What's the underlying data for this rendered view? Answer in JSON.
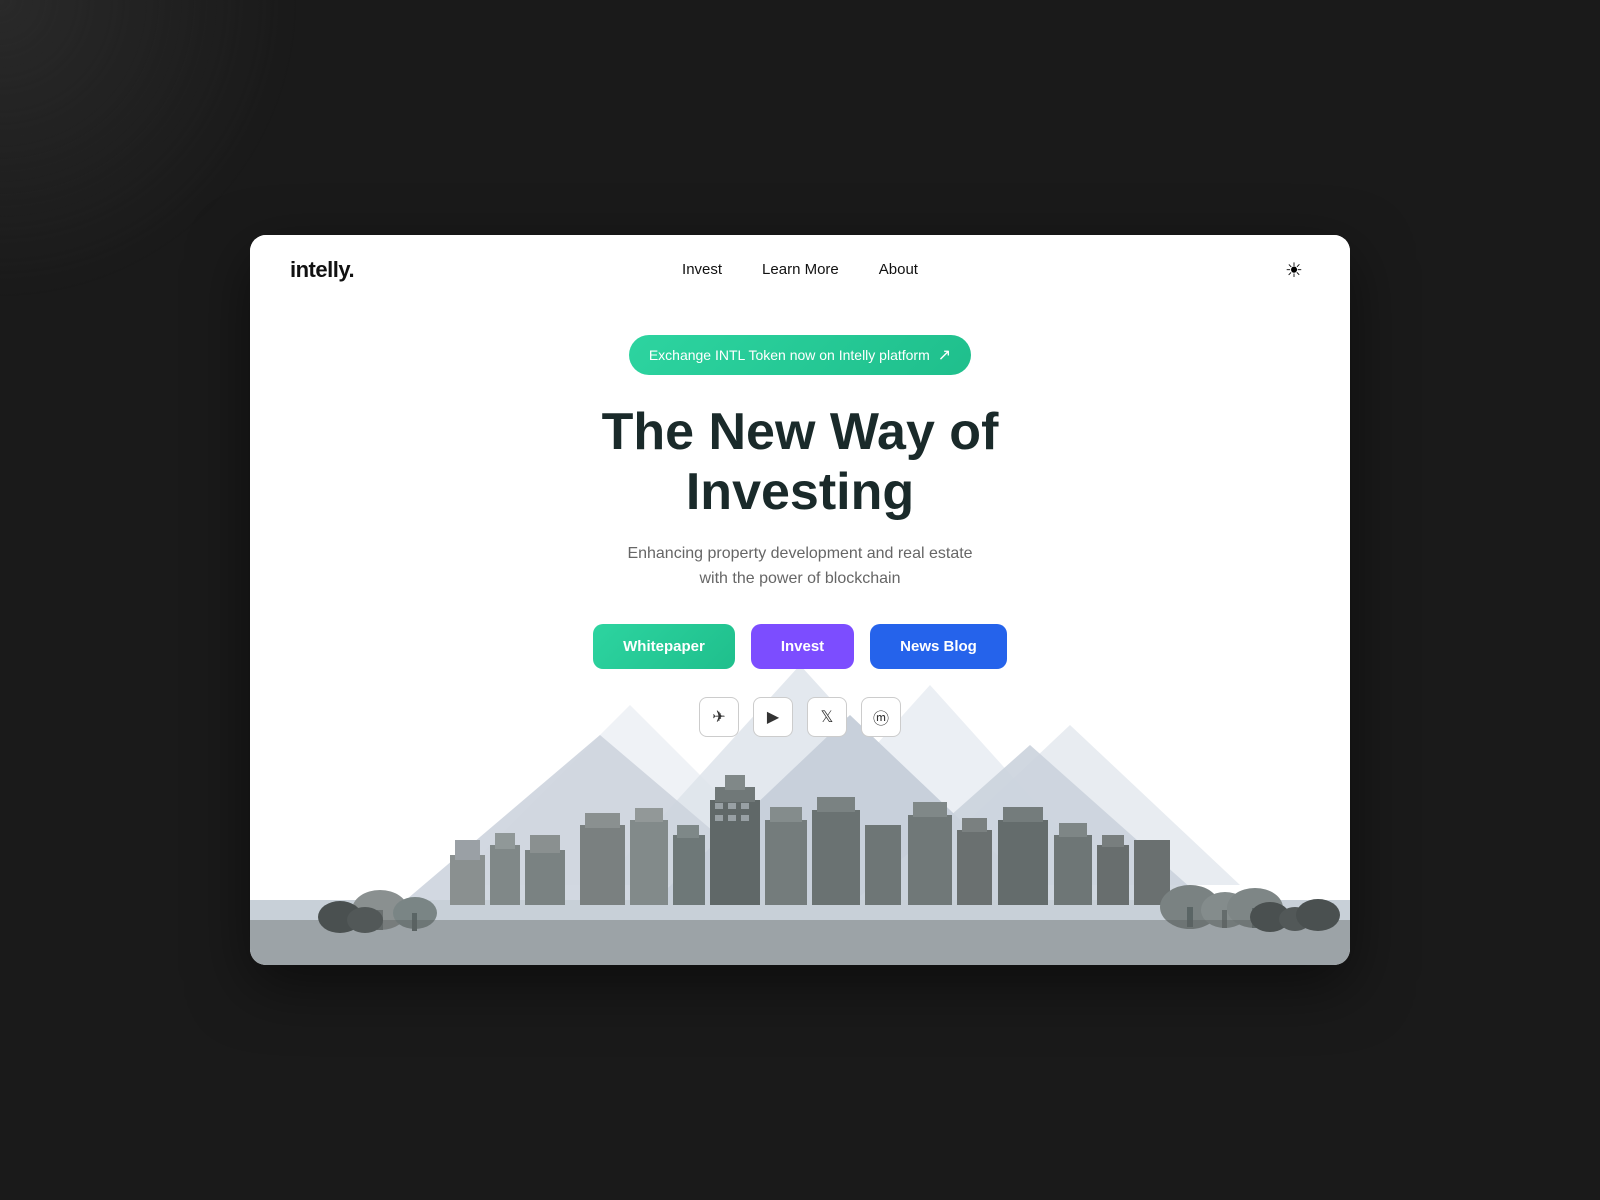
{
  "logo": {
    "text": "intelly."
  },
  "navbar": {
    "links": [
      {
        "label": "Invest",
        "id": "nav-invest"
      },
      {
        "label": "Learn More",
        "id": "nav-learn-more"
      },
      {
        "label": "About",
        "id": "nav-about"
      }
    ],
    "theme_icon": "☀"
  },
  "hero": {
    "badge_text": "Exchange INTL Token now on Intelly platform",
    "badge_arrow": "↗",
    "title_line1": "The New Way of",
    "title_line2": "Investing",
    "subtitle": "Enhancing property development and real estate with the power of blockchain",
    "buttons": {
      "whitepaper": "Whitepaper",
      "invest": "Invest",
      "newsblog": "News Blog"
    }
  },
  "social": {
    "icons": [
      {
        "name": "telegram-icon",
        "symbol": "✈"
      },
      {
        "name": "youtube-icon",
        "symbol": "▶"
      },
      {
        "name": "twitter-icon",
        "symbol": "𝕏"
      },
      {
        "name": "medium-icon",
        "symbol": "M"
      }
    ]
  },
  "colors": {
    "green": "#2dd4a0",
    "purple": "#7c4dff",
    "blue": "#2563eb",
    "text_dark": "#1a2a2a",
    "text_muted": "#666666"
  }
}
